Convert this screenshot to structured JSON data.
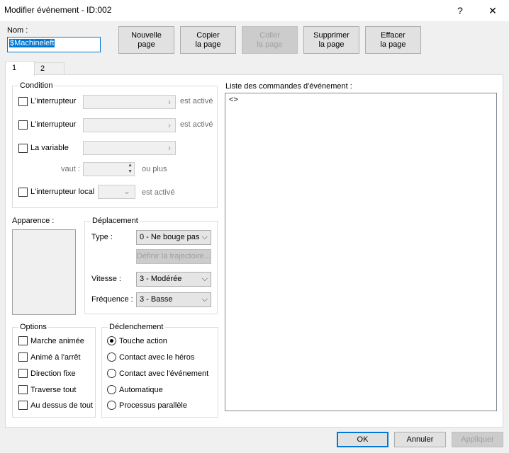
{
  "window": {
    "title": "Modifier événement - ID:002",
    "help_label": "?",
    "close_label": "✕"
  },
  "name": {
    "label": "Nom :",
    "value": "$Machineleft"
  },
  "page_buttons": {
    "new": "Nouvelle\npage",
    "copy": "Copier\nla page",
    "paste": "Coller\nla page",
    "delete": "Supprimer\nla page",
    "clear": "Effacer\nla page"
  },
  "tabs": [
    "1",
    "2"
  ],
  "condition": {
    "title": "Condition",
    "switch1_label": "L'interrupteur",
    "switch1_suffix": "est activé",
    "switch2_label": "L'interrupteur",
    "switch2_suffix": "est activé",
    "variable_label": "La variable",
    "vaut_label": "vaut :",
    "or_more": "ou plus",
    "local_switch_label": "L'interrupteur local",
    "local_switch_suffix": "est activé"
  },
  "appearance": {
    "label": "Apparence :"
  },
  "movement": {
    "title": "Déplacement",
    "type_label": "Type :",
    "type_value": "0 - Ne bouge pas",
    "route_button": "Définir la trajectoire...",
    "speed_label": "Vitesse :",
    "speed_value": "3 - Modérée",
    "freq_label": "Fréquence :",
    "freq_value": "3 - Basse"
  },
  "options": {
    "title": "Options",
    "items": [
      "Marche animée",
      "Animé à l'arrêt",
      "Direction fixe",
      "Traverse tout",
      "Au dessus de tout"
    ]
  },
  "trigger": {
    "title": "Déclenchement",
    "items": [
      "Touche action",
      "Contact avec le héros",
      "Contact avec l'événement",
      "Automatique",
      "Processus parallèle"
    ],
    "selected": "Touche action"
  },
  "commands": {
    "label": "Liste des commandes d'événement :",
    "items": [
      "<>"
    ]
  },
  "footer": {
    "ok": "OK",
    "cancel": "Annuler",
    "apply": "Appliquer"
  }
}
